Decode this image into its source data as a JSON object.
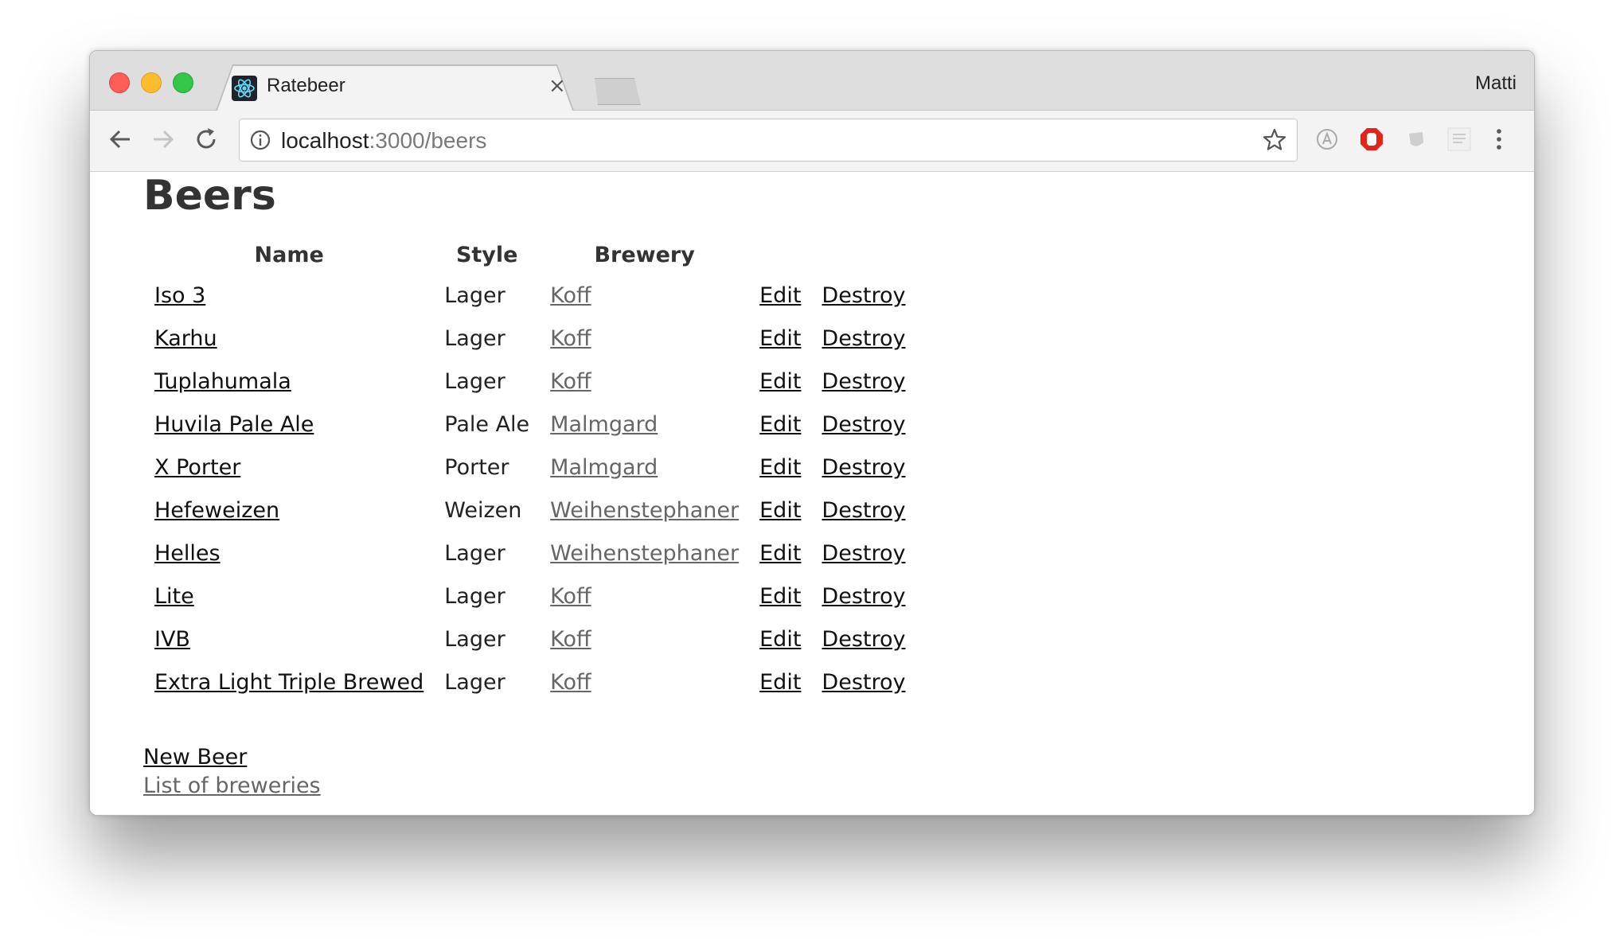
{
  "browser": {
    "tab_title": "Ratebeer",
    "tab_close": "×",
    "profile_name": "Matti",
    "url_host": "localhost",
    "url_path": ":3000/beers"
  },
  "page": {
    "title": "Beers",
    "columns": [
      "Name",
      "Style",
      "Brewery"
    ],
    "rows": [
      {
        "name": "Iso 3",
        "style": "Lager",
        "brewery": "Koff",
        "edit": "Edit",
        "destroy": "Destroy"
      },
      {
        "name": "Karhu",
        "style": "Lager",
        "brewery": "Koff",
        "edit": "Edit",
        "destroy": "Destroy"
      },
      {
        "name": "Tuplahumala",
        "style": "Lager",
        "brewery": "Koff",
        "edit": "Edit",
        "destroy": "Destroy"
      },
      {
        "name": "Huvila Pale Ale",
        "style": "Pale Ale",
        "brewery": "Malmgard",
        "edit": "Edit",
        "destroy": "Destroy"
      },
      {
        "name": "X Porter",
        "style": "Porter",
        "brewery": "Malmgard",
        "edit": "Edit",
        "destroy": "Destroy"
      },
      {
        "name": "Hefeweizen",
        "style": "Weizen",
        "brewery": "Weihenstephaner",
        "edit": "Edit",
        "destroy": "Destroy"
      },
      {
        "name": "Helles",
        "style": "Lager",
        "brewery": "Weihenstephaner",
        "edit": "Edit",
        "destroy": "Destroy"
      },
      {
        "name": "Lite",
        "style": "Lager",
        "brewery": "Koff",
        "edit": "Edit",
        "destroy": "Destroy"
      },
      {
        "name": "IVB",
        "style": "Lager",
        "brewery": "Koff",
        "edit": "Edit",
        "destroy": "Destroy"
      },
      {
        "name": "Extra Light Triple Brewed",
        "style": "Lager",
        "brewery": "Koff",
        "edit": "Edit",
        "destroy": "Destroy"
      }
    ],
    "new_beer_link": "New Beer",
    "breweries_link": "List of breweries"
  },
  "icons": {
    "back": "arrow-left-icon",
    "forward": "arrow-right-icon",
    "reload": "reload-icon",
    "info": "info-icon",
    "bookmark": "star-icon",
    "menu": "kebab-menu-icon"
  }
}
